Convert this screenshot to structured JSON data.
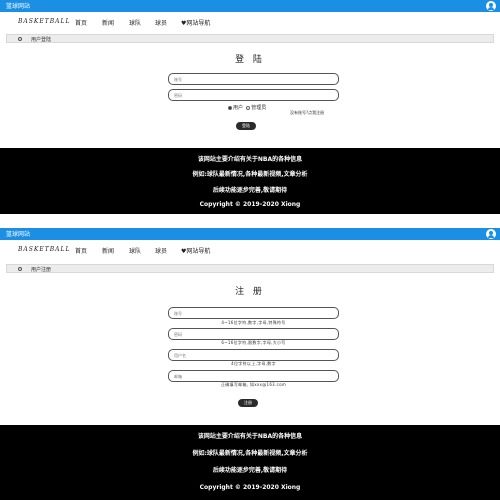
{
  "site_name": "篮球网站",
  "logo_text": "BASKETBALL",
  "nav": {
    "home": "首页",
    "news": "新闻",
    "teams": "球队",
    "players": "球员",
    "site_nav": "♥网站导航"
  },
  "login_section": {
    "breadcrumb": "用户登陆",
    "title": "登 陆",
    "account_placeholder": "账号",
    "password_placeholder": "密码",
    "role_user": "用户",
    "role_admin": "管理员",
    "register_link": "没有账号?点我注册",
    "submit": "登陆"
  },
  "register_section": {
    "breadcrumb": "用户注册",
    "title": "注 册",
    "account_placeholder": "账号",
    "account_hint": "4~16位字符,数字,字母,特殊符号",
    "password_placeholder": "密码",
    "password_hint": "6~16位字符,限数字,字母,大小写",
    "username_placeholder": "用户名",
    "username_hint": "4位字符以上,字母,数字",
    "email_placeholder": "邮箱",
    "email_hint": "正确填写邮箱, 如xxx@163.com",
    "submit": "注册"
  },
  "footer": {
    "line1": "该网站主要介绍有关于NBA的各种信息",
    "line2": "例如:球队最新情况,各种最新视频,文章分析",
    "line3": "后续功能逐步完善,敬请期待",
    "line4": "Copyright © 2019-2020 Xiong"
  },
  "colors": {
    "topbar": "#1a8fe3",
    "footer": "#000000",
    "button": "#2b2b2b"
  },
  "icons": {
    "user": "user-circle-icon",
    "breadcrumb": "circle-icon"
  }
}
